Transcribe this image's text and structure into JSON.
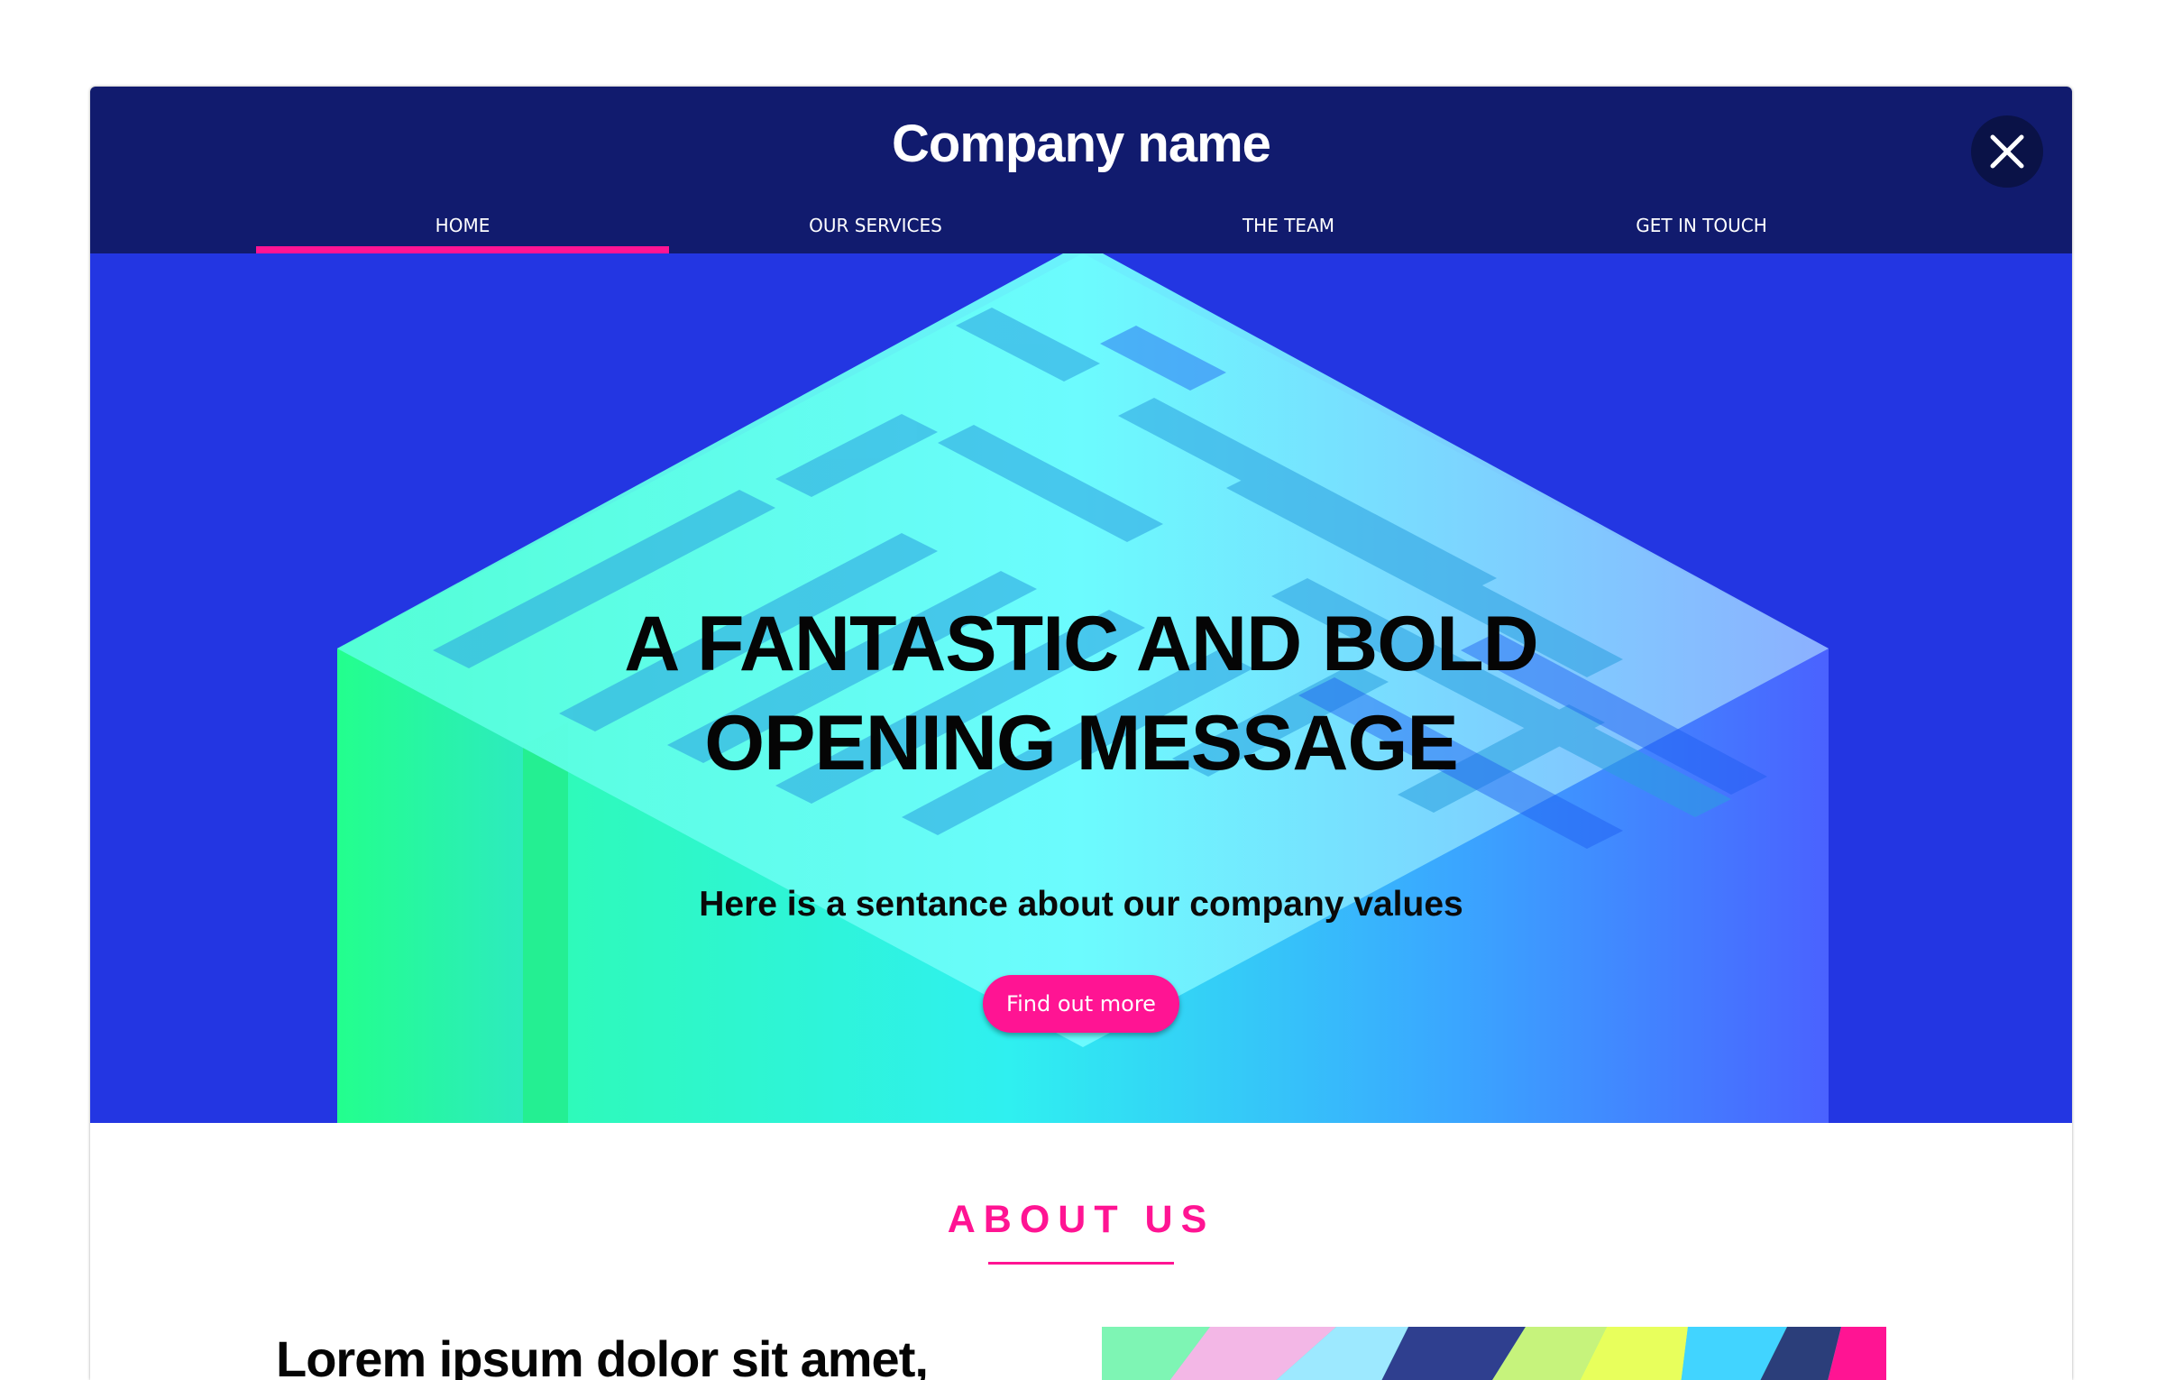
{
  "header": {
    "brand": "Company name",
    "close_icon": "close-icon",
    "nav": [
      {
        "label": "HOME",
        "active": true
      },
      {
        "label": "OUR SERVICES",
        "active": false
      },
      {
        "label": "THE TEAM",
        "active": false
      },
      {
        "label": "GET IN TOUCH",
        "active": false
      }
    ]
  },
  "hero": {
    "title_line1": "A FANTASTIC AND BOLD",
    "title_line2": "OPENING MESSAGE",
    "subtitle": "Here is a sentance about our company values",
    "cta_label": "Find out more",
    "background_image": "isometric-maze-illustration"
  },
  "about": {
    "title": "ABOUT US",
    "heading": "Lorem ipsum dolor sit amet,",
    "image": "low-poly-colorful-illustration"
  },
  "colors": {
    "header_bg": "#111b6e",
    "hero_bg": "#2336e2",
    "accent": "#ff1493",
    "close_button_bg": "#0a1247"
  }
}
